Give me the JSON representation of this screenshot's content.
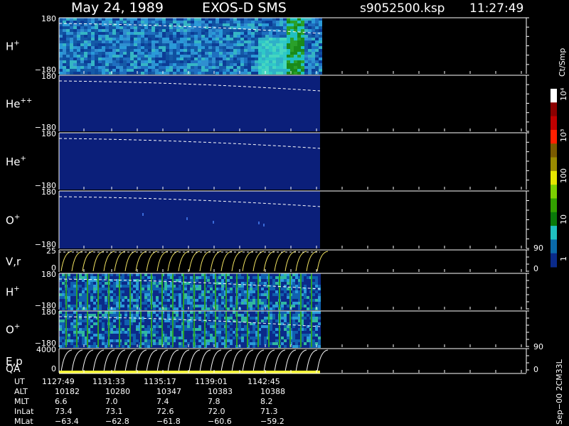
{
  "header": {
    "date": "May 24, 1989",
    "instrument": "EXOS-D SMS",
    "file": "s9052500.ksp",
    "time": "11:27:49"
  },
  "colors": {
    "spectrogram_bg": "#0b1f7a",
    "boundary": "#ffffff",
    "velocity_curves": "#f5e663",
    "energy_curves": "#ffffff",
    "qa_bar": "#f5f536"
  },
  "colorbar": {
    "unit": "Ct/Smp",
    "labels": [
      "10⁴",
      "10³",
      "100",
      "10",
      "1"
    ],
    "stops": [
      "#ffffff",
      "#8b0000",
      "#c00000",
      "#ff2000",
      "#7a5a00",
      "#9a8a00",
      "#e6e600",
      "#7ccf00",
      "#33a000",
      "#0a7a0a",
      "#20c0c0",
      "#0a6aaa",
      "#0a2a8a"
    ]
  },
  "panels": [
    {
      "label": "H",
      "sup": "+",
      "tick_top": "180",
      "tick_bottom": "−180"
    },
    {
      "label": "He",
      "sup": "++",
      "tick_top": "180",
      "tick_bottom": "−180"
    },
    {
      "label": "He",
      "sup": "+",
      "tick_top": "180",
      "tick_bottom": "−180"
    },
    {
      "label": "O",
      "sup": "+",
      "tick_top": "180",
      "tick_bottom": "−180"
    },
    {
      "label": "V,r",
      "sup": "",
      "tick_top": "25",
      "tick_bottom": "0",
      "right_top": "90",
      "right_bottom": "0"
    },
    {
      "label": "H",
      "sup": "+",
      "tick_top": "180",
      "tick_bottom": "−180"
    },
    {
      "label": "O",
      "sup": "+",
      "tick_top": "180",
      "tick_bottom": "−180"
    },
    {
      "label": "E,p",
      "sup": "",
      "label2": "QA",
      "tick_top": "4000",
      "tick_bottom": "0",
      "right_top": "90",
      "right_bottom": "0"
    }
  ],
  "footer": {
    "row_labels": [
      "UT",
      "ALT",
      "MLT",
      "InLat",
      "MLat"
    ],
    "columns": [
      [
        "1127:49",
        "10182",
        "6.6",
        "73.4",
        "−63.4"
      ],
      [
        "1131:33",
        "10280",
        "7.0",
        "73.1",
        "−62.8"
      ],
      [
        "1135:17",
        "10347",
        "7.4",
        "72.6",
        "−61.8"
      ],
      [
        "1139:01",
        "10383",
        "7.8",
        "72.0",
        "−60.6"
      ],
      [
        "1142:45",
        "10388",
        "8.2",
        "71.3",
        "−59.2"
      ]
    ],
    "side_note": "Sep−00 2CM33L"
  }
}
